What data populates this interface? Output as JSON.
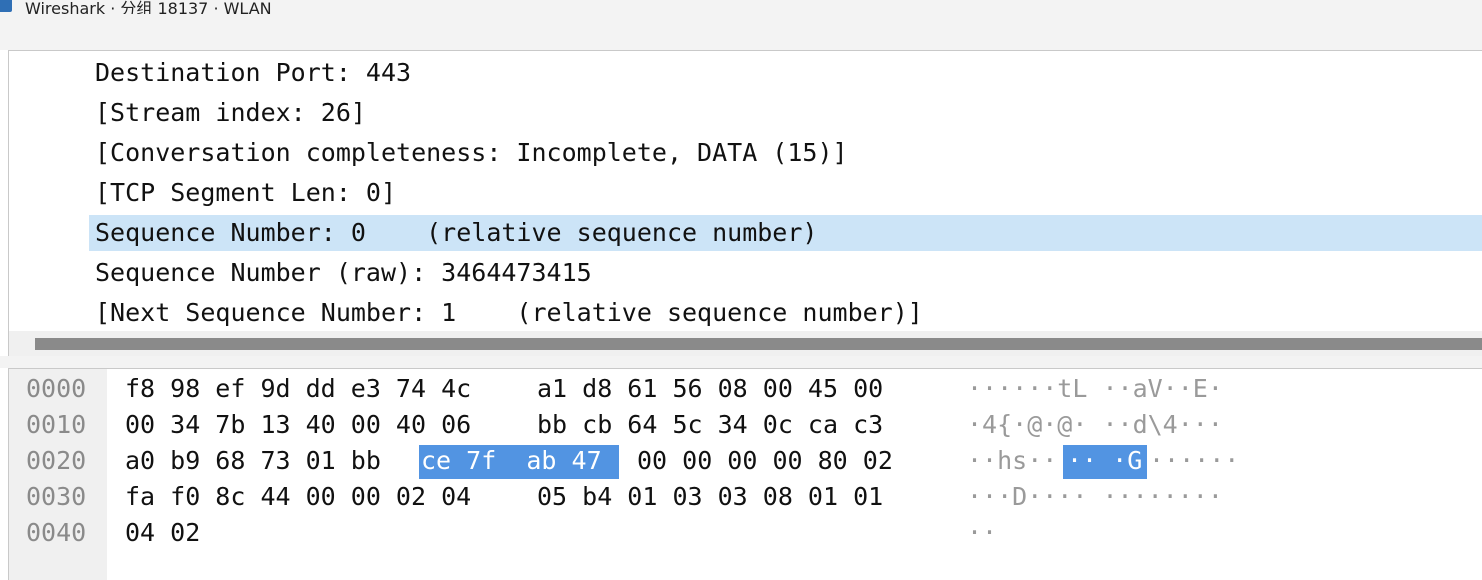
{
  "window": {
    "title": "Wireshark · 分组 18137 · WLAN"
  },
  "details": {
    "lines": [
      "Destination Port: 443",
      "[Stream index: 26]",
      "[Conversation completeness: Incomplete, DATA (15)]",
      "[TCP Segment Len: 0]",
      "Sequence Number: 0    (relative sequence number)",
      "Sequence Number (raw): 3464473415",
      "[Next Sequence Number: 1    (relative sequence number)]"
    ],
    "selected_index": 4
  },
  "bytes": {
    "rows": [
      {
        "offset": "0000",
        "hex_a": "f8 98 ef 9d dd e3 74 4c",
        "hex_b": "a1 d8 61 56 08 00 45 00",
        "ascii": "······tL ··aV··E·"
      },
      {
        "offset": "0010",
        "hex_a": "00 34 7b 13 40 00 40 06",
        "hex_b": "bb cb 64 5c 34 0c ca c3",
        "ascii": "·4{·@·@· ··d\\4···"
      },
      {
        "offset": "0020",
        "hex_a": "a0 b9 68 73 01 bb",
        "hex_sel": "ce 7f  ab 47",
        "hex_b": "00 00 00 00 80 02",
        "ascii_pre": "··hs··",
        "ascii_sel": "·· ·G",
        "ascii_post": "······"
      },
      {
        "offset": "0030",
        "hex_a": "fa f0 8c 44 00 00 02 04",
        "hex_b": "05 b4 01 03 03 08 01 01",
        "ascii": "···D···· ········"
      },
      {
        "offset": "0040",
        "hex_a": "04 02",
        "hex_b": "",
        "ascii": "··"
      }
    ]
  },
  "colors": {
    "selection_light": "#cce4f7",
    "selection_dark": "#5294e2"
  }
}
